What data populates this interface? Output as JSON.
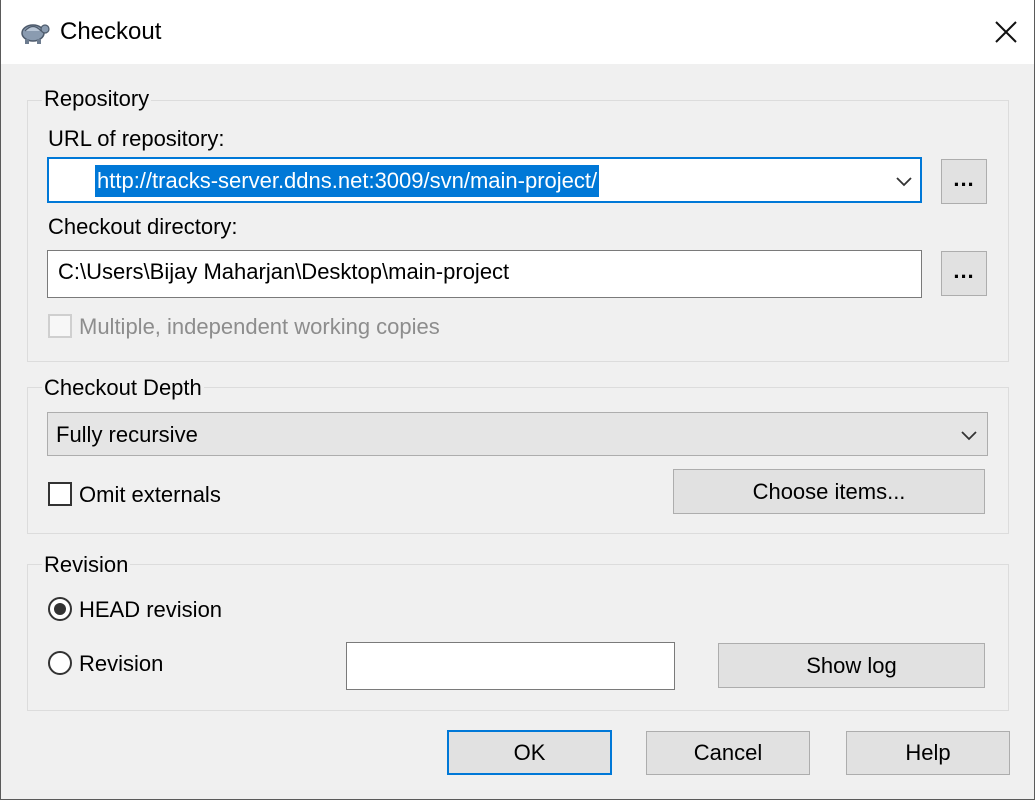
{
  "window": {
    "title": "Checkout",
    "app_icon": "tortoisesvn-icon",
    "close_icon": "close-icon"
  },
  "repository": {
    "legend": "Repository",
    "url_label": "URL of repository:",
    "url_value": "http://tracks-server.ddns.net:3009/svn/main-project/",
    "url_browse_label": "...",
    "dir_label": "Checkout directory:",
    "dir_value": "C:\\Users\\Bijay Maharjan\\Desktop\\main-project",
    "dir_browse_label": "...",
    "multiple_copies_label": "Multiple, independent working copies",
    "multiple_copies_checked": false
  },
  "depth": {
    "legend": "Checkout Depth",
    "selected": "Fully recursive",
    "omit_externals_label": "Omit externals",
    "omit_externals_checked": false,
    "choose_items_label": "Choose items..."
  },
  "revision": {
    "legend": "Revision",
    "head_label": "HEAD revision",
    "revision_label": "Revision",
    "selected": "HEAD revision",
    "revision_value": "",
    "show_log_label": "Show log"
  },
  "buttons": {
    "ok": "OK",
    "cancel": "Cancel",
    "help": "Help"
  },
  "colors": {
    "accent": "#0078d7",
    "background": "#f0f0f0",
    "button": "#e1e1e1"
  }
}
